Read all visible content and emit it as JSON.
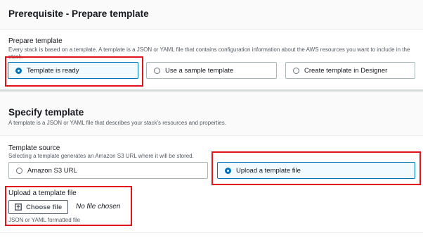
{
  "prerequisite": {
    "title": "Prerequisite - Prepare template",
    "field_label": "Prepare template",
    "description": "Every stack is based on a template. A template is a JSON or YAML file that contains configuration information about the AWS resources you want to include in the stack.",
    "options": [
      {
        "label": "Template is ready",
        "selected": true
      },
      {
        "label": "Use a sample template",
        "selected": false
      },
      {
        "label": "Create template in Designer",
        "selected": false
      }
    ]
  },
  "specify": {
    "title": "Specify template",
    "description": "A template is a JSON or YAML file that describes your stack's resources and properties.",
    "source_label": "Template source",
    "source_description": "Selecting a template generates an Amazon S3 URL where it will be stored.",
    "sources": [
      {
        "label": "Amazon S3 URL",
        "selected": false
      },
      {
        "label": "Upload a template file",
        "selected": true
      }
    ]
  },
  "upload": {
    "label": "Upload a template file",
    "button_label": "Choose file",
    "status": "No file chosen",
    "hint": "JSON or YAML formatted file"
  },
  "colors": {
    "accent": "#0073bb",
    "highlight": "#e0141a"
  },
  "icons": {
    "upload": "upload-icon"
  }
}
